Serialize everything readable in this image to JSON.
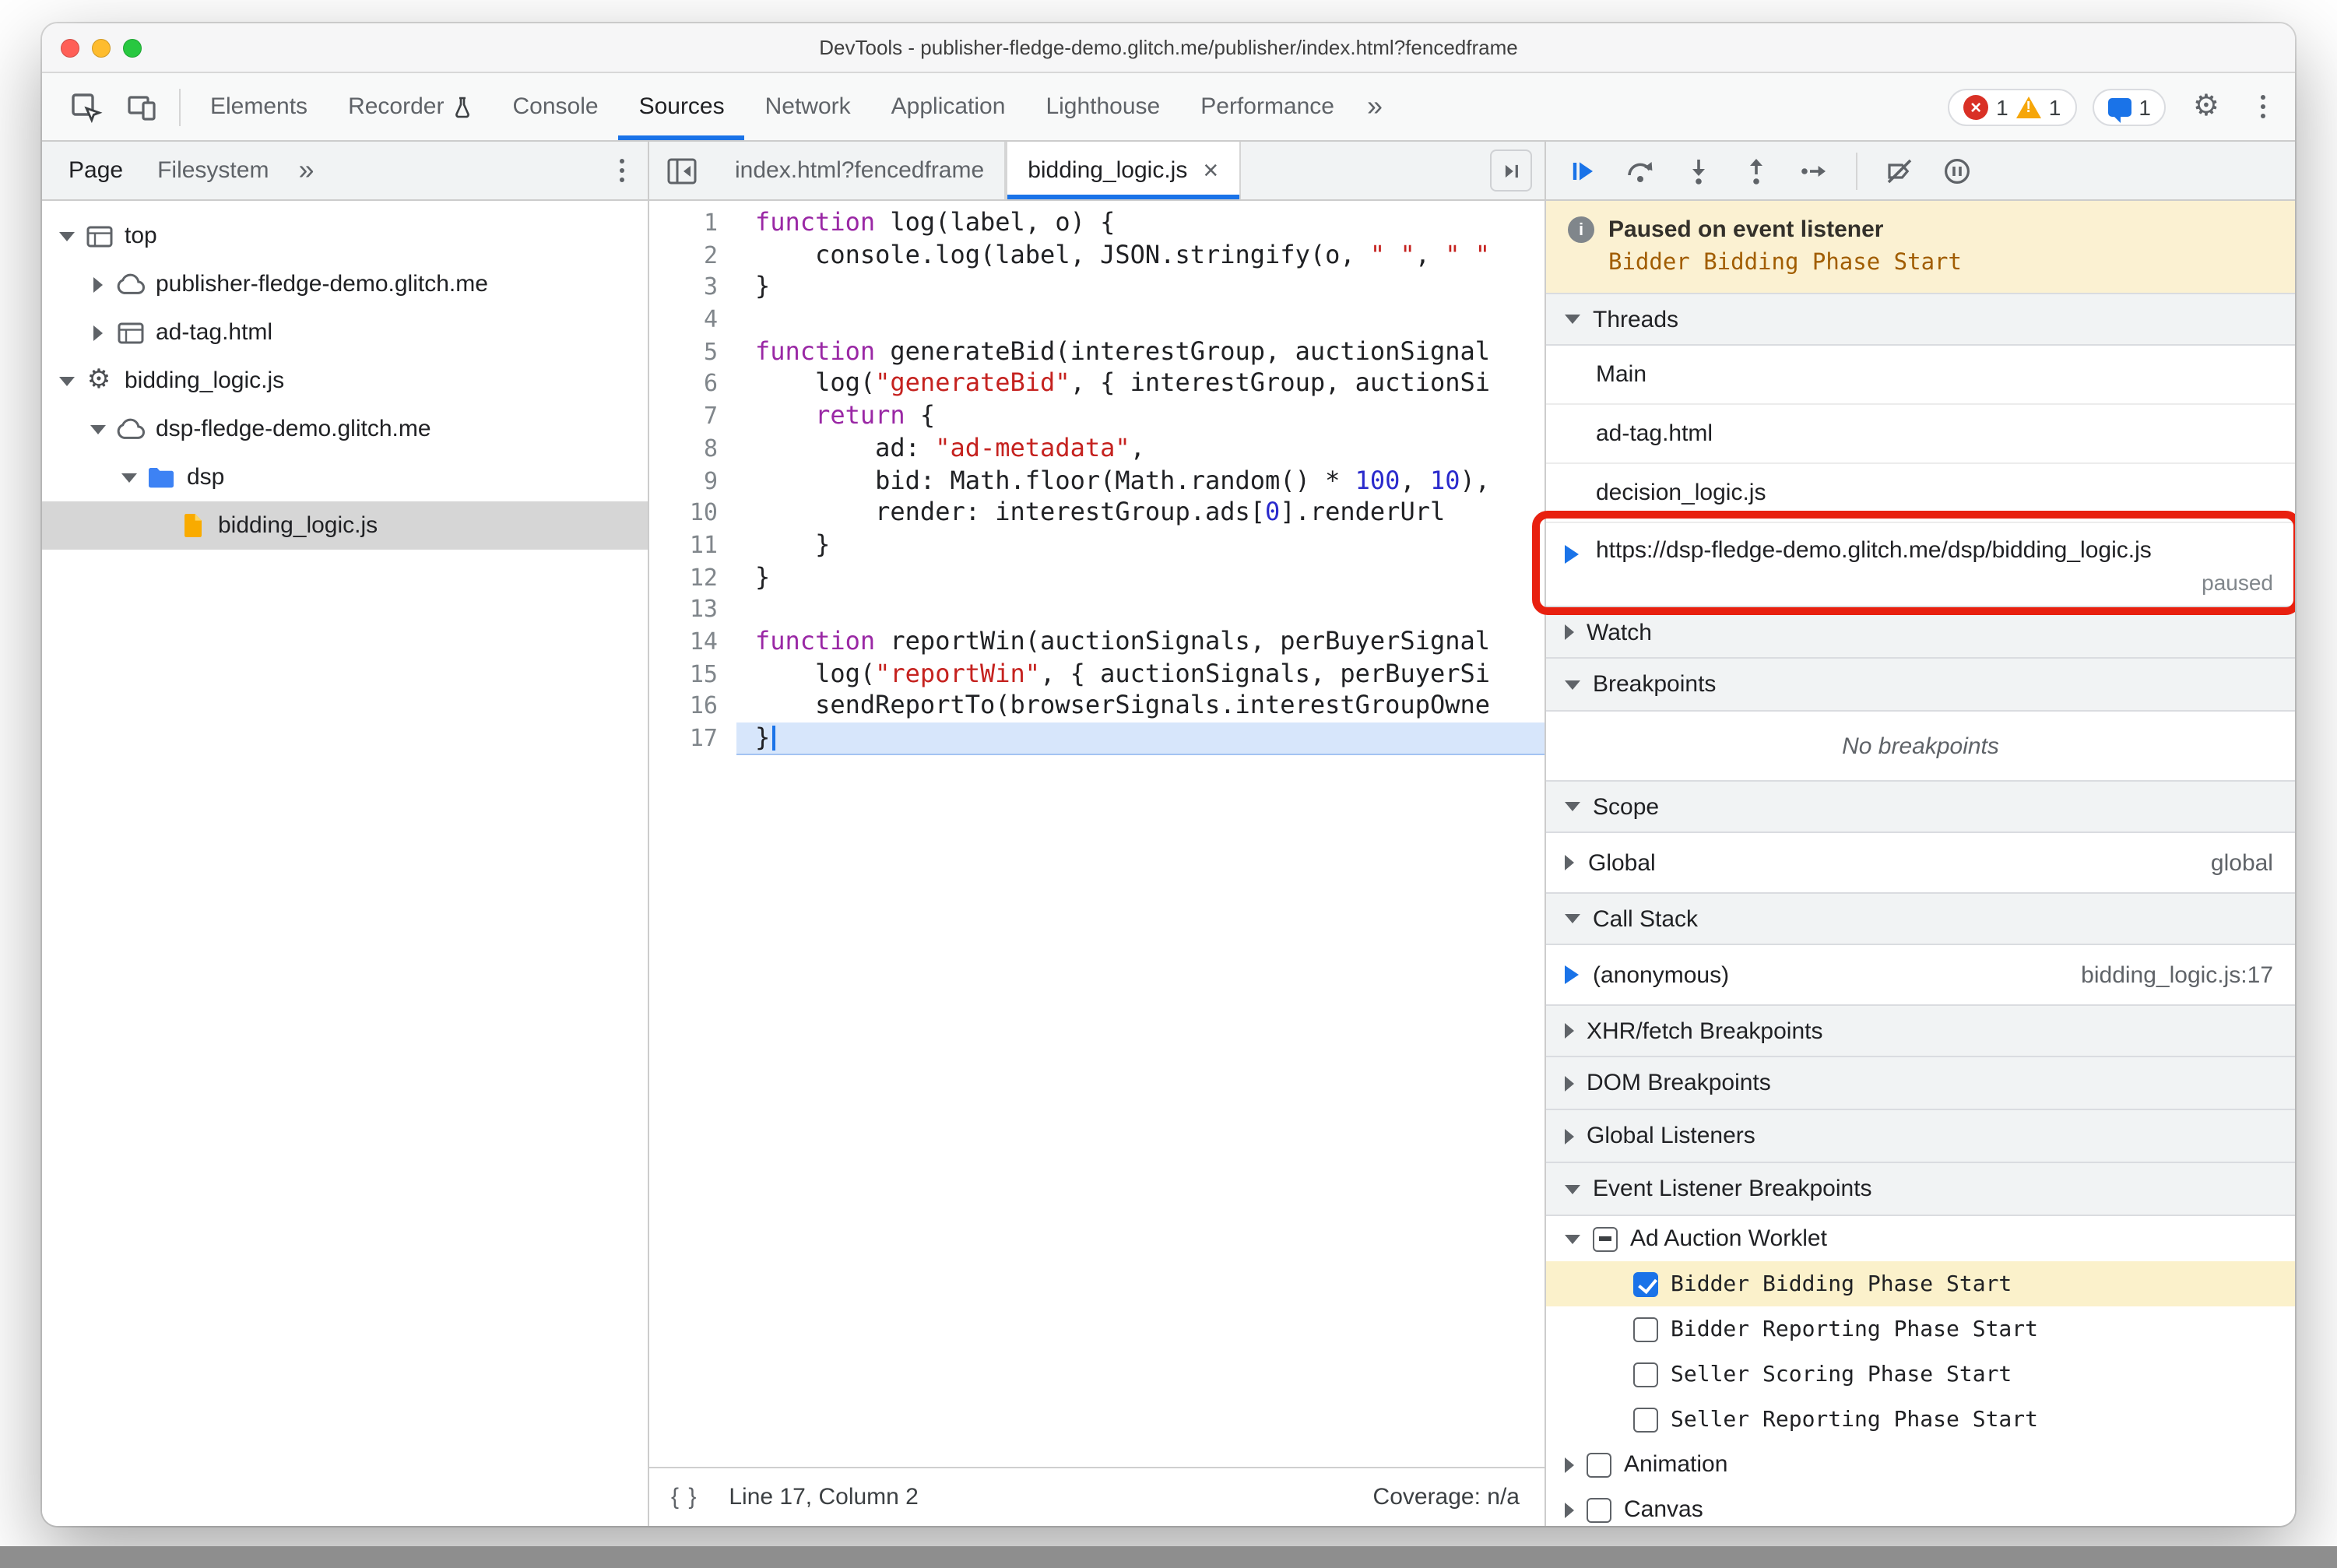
{
  "window_title": "DevTools - publisher-fledge-demo.glitch.me/publisher/index.html?fencedframe",
  "icons": {
    "gear": "⚙",
    "more_chevron": "»",
    "close": "×",
    "pretty_print": "{ }",
    "error": "×",
    "warning": "!",
    "info": "i"
  },
  "main_toolbar": {
    "tabs": [
      {
        "label": "Elements"
      },
      {
        "label": "Recorder",
        "has_flask_icon": true
      },
      {
        "label": "Console"
      },
      {
        "label": "Sources",
        "active": true
      },
      {
        "label": "Network"
      },
      {
        "label": "Application"
      },
      {
        "label": "Lighthouse"
      },
      {
        "label": "Performance"
      }
    ],
    "error_count": "1",
    "warning_count": "1",
    "issue_count": "1"
  },
  "navigator": {
    "tabs": [
      {
        "label": "Page",
        "active": true
      },
      {
        "label": "Filesystem"
      }
    ],
    "tree": [
      {
        "label": "top",
        "icon": "frame",
        "expander": "expanded",
        "level": 0
      },
      {
        "label": "publisher-fledge-demo.glitch.me",
        "icon": "cloud",
        "expander": "collapsed",
        "level": 1
      },
      {
        "label": "ad-tag.html",
        "icon": "frame",
        "expander": "collapsed",
        "level": 1
      },
      {
        "label": "bidding_logic.js",
        "icon": "gear",
        "expander": "expanded",
        "level": 0
      },
      {
        "label": "dsp-fledge-demo.glitch.me",
        "icon": "cloud",
        "expander": "expanded",
        "level": 1
      },
      {
        "label": "dsp",
        "icon": "folder",
        "expander": "expanded",
        "level": 2
      },
      {
        "label": "bidding_logic.js",
        "icon": "js-file",
        "expander": "none",
        "level": 3,
        "selected": true
      }
    ]
  },
  "editor": {
    "tabs": [
      {
        "label": "index.html?fencedframe"
      },
      {
        "label": "bidding_logic.js",
        "active": true,
        "closable": true
      }
    ],
    "current_line": 17,
    "lines": [
      [
        [
          "k",
          "function"
        ],
        [
          "p",
          " log(label, o) {"
        ]
      ],
      [
        [
          "p",
          "    console.log(label, JSON.stringify(o, "
        ],
        [
          "s",
          "\" \""
        ],
        [
          "p",
          ", "
        ],
        [
          "s",
          "\" \""
        ]
      ],
      [
        [
          "p",
          "}"
        ]
      ],
      [],
      [
        [
          "k",
          "function"
        ],
        [
          "p",
          " generateBid(interestGroup, auctionSignal"
        ]
      ],
      [
        [
          "p",
          "    log("
        ],
        [
          "s",
          "\"generateBid\""
        ],
        [
          "p",
          ", { interestGroup, auctionSi"
        ]
      ],
      [
        [
          "p",
          "    "
        ],
        [
          "k",
          "return"
        ],
        [
          "p",
          " {"
        ]
      ],
      [
        [
          "p",
          "        ad: "
        ],
        [
          "s",
          "\"ad-metadata\""
        ],
        [
          "p",
          ","
        ]
      ],
      [
        [
          "p",
          "        bid: Math.floor(Math.random() * "
        ],
        [
          "n",
          "100"
        ],
        [
          "p",
          ", "
        ],
        [
          "n",
          "10"
        ],
        [
          "p",
          "),"
        ]
      ],
      [
        [
          "p",
          "        render: interestGroup.ads["
        ],
        [
          "n",
          "0"
        ],
        [
          "p",
          "].renderUrl"
        ]
      ],
      [
        [
          "p",
          "    }"
        ]
      ],
      [
        [
          "p",
          "}"
        ]
      ],
      [],
      [
        [
          "k",
          "function"
        ],
        [
          "p",
          " reportWin(auctionSignals, perBuyerSignal"
        ]
      ],
      [
        [
          "p",
          "    log("
        ],
        [
          "s",
          "\"reportWin\""
        ],
        [
          "p",
          ", { auctionSignals, perBuyerSi"
        ]
      ],
      [
        [
          "p",
          "    sendReportTo(browserSignals.interestGroupOwne"
        ]
      ],
      [
        [
          "p",
          "}"
        ]
      ]
    ],
    "status_left": "Line 17, Column 2",
    "status_right": "Coverage: n/a"
  },
  "debugger": {
    "paused_title": "Paused on event listener",
    "paused_detail": "Bidder Bidding Phase Start",
    "threads_title": "Threads",
    "threads": [
      {
        "label": "Main"
      },
      {
        "label": "ad-tag.html"
      },
      {
        "label": "decision_logic.js"
      },
      {
        "label": "https://dsp-fledge-demo.glitch.me/dsp/bidding_logic.js",
        "status": "paused",
        "active": true,
        "annotated": true
      }
    ],
    "watch_title": "Watch",
    "breakpoints_title": "Breakpoints",
    "breakpoints_empty": "No breakpoints",
    "scope_title": "Scope",
    "scope_label": "Global",
    "scope_hint": "global",
    "call_stack_title": "Call Stack",
    "cs_name": "(anonymous)",
    "cs_loc": "bidding_logic.js:17",
    "xhr_title": "XHR/fetch Breakpoints",
    "dom_title": "DOM Breakpoints",
    "gl_title": "Global Listeners",
    "elb_title": "Event Listener Breakpoints",
    "elb_groups": [
      {
        "label": "Ad Auction Worklet",
        "checkbox": "indeterminate",
        "expanded": true,
        "children": [
          {
            "label": "Bidder Bidding Phase Start",
            "checkbox": "checked",
            "highlight": true
          },
          {
            "label": "Bidder Reporting Phase Start",
            "checkbox": "unchecked"
          },
          {
            "label": "Seller Scoring Phase Start",
            "checkbox": "unchecked"
          },
          {
            "label": "Seller Reporting Phase Start",
            "checkbox": "unchecked"
          }
        ]
      },
      {
        "label": "Animation",
        "checkbox": "unchecked",
        "expanded": false
      },
      {
        "label": "Canvas",
        "checkbox": "unchecked",
        "expanded": false
      }
    ]
  },
  "colors": {
    "accent_blue": "#1a73e8",
    "annotation_red": "#e8200f",
    "paused_banner_bg": "#fbf1d2",
    "paused_detail_text": "#a15d00",
    "execution_line_bg": "#d7e6fb",
    "selected_row_bg": "#d6d6d6",
    "breakpoint_highlight_bg": "#fbf1cb",
    "error_red": "#d93025",
    "warning_yellow": "#f6a609",
    "folder_blue": "#3d82f4",
    "js_file_orange": "#f9ab00"
  }
}
